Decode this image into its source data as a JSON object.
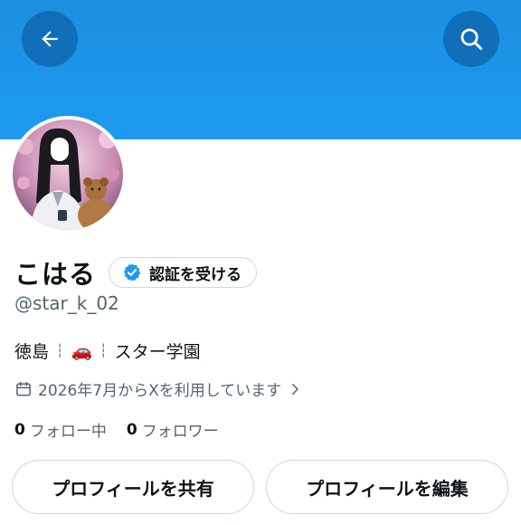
{
  "profile": {
    "display_name": "こはる",
    "verify_label": "認証を受ける",
    "handle": "@star_k_02",
    "bio": {
      "place": "徳島",
      "emoji": "🚗",
      "school": "スター学園"
    },
    "joined": "2026年7月からXを利用しています",
    "following_count": "0",
    "following_label": "フォロー中",
    "followers_count": "0",
    "followers_label": "フォロワー"
  },
  "actions": {
    "share_label": "プロフィールを共有",
    "edit_label": "プロフィールを編集"
  },
  "icons": {
    "back": "arrow-left-icon",
    "search": "search-icon",
    "verified": "verified-badge-icon",
    "calendar": "calendar-icon",
    "chevron": "chevron-right-icon"
  },
  "colors": {
    "banner": "#1d9bf0",
    "accent": "#1d9bf0",
    "secondary_text": "#536471",
    "border": "#cfd9de"
  }
}
